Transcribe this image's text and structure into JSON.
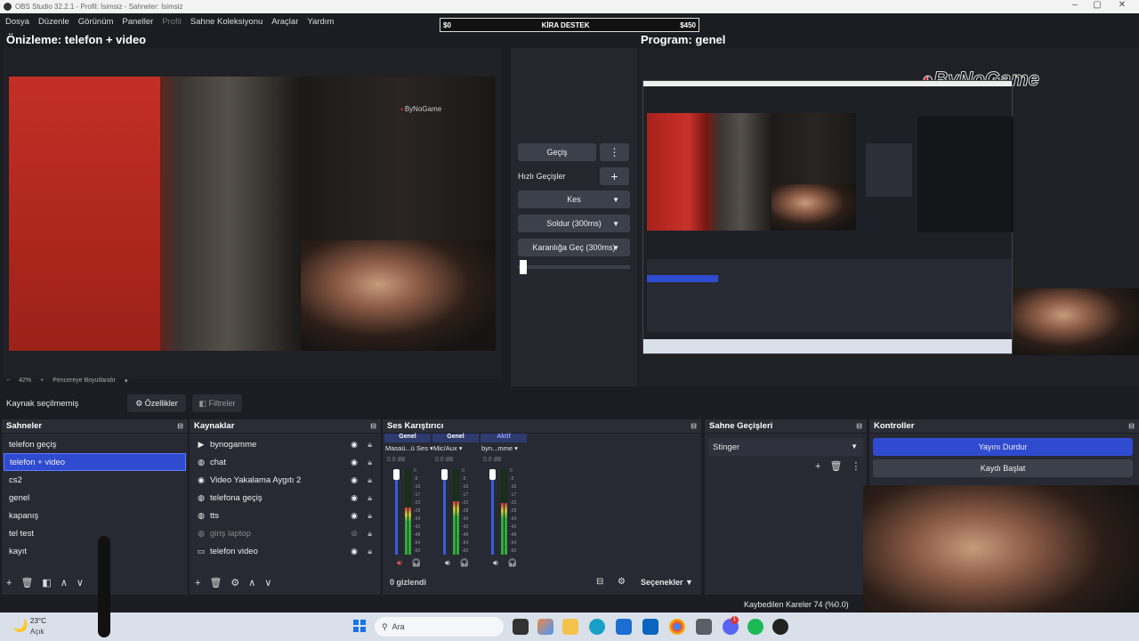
{
  "window": {
    "title": "OBS Studio 32.2.1 - Profil: İsimsiz - Sahneler: İsimsiz",
    "min": "–",
    "max": "▢",
    "close": "✕"
  },
  "menu": [
    "Dosya",
    "Düzenle",
    "Görünüm",
    "Paneller",
    "Profil",
    "Sahne Koleksiyonu",
    "Araçlar",
    "Yardım"
  ],
  "rent": {
    "left": "$0",
    "title": "KİRA DESTEK",
    "right": "$450"
  },
  "preview": {
    "title": "Önizleme: telefon + video",
    "zoom_minus": "−",
    "zoom": "42%",
    "zoom_plus": "+",
    "fit": "Pencereye Boyutlandır",
    "watermark": "ByNoGame"
  },
  "program": {
    "title": "Program: genel",
    "watermark": "ByNoGame"
  },
  "transitions": {
    "gecis": "Geçiş",
    "quick": "Hızlı Geçişler",
    "kes": "Kes",
    "soldur": "Soldur (300ms)",
    "karanlik": "Karanlığa Geç (300ms)",
    "slider": 0.02
  },
  "sourcebar": {
    "status": "Kaynak seçilmemiş",
    "props": "Özellikler",
    "filters": "Filtreler"
  },
  "scenes": {
    "title": "Sahneler",
    "items": [
      "telefon geçiş",
      "telefon + video",
      "cs2",
      "genel",
      "kapanış",
      "tel test",
      "kayıt"
    ],
    "selected": 1
  },
  "sources": {
    "title": "Kaynaklar",
    "items": [
      {
        "icon": "play-icon",
        "glyph": "▶",
        "name": "bynogamme",
        "hidden": false
      },
      {
        "icon": "globe-icon",
        "glyph": "◍",
        "name": "chat",
        "hidden": false
      },
      {
        "icon": "camera-icon",
        "glyph": "◉",
        "name": "Video Yakalama Aygıtı 2",
        "hidden": false
      },
      {
        "icon": "globe-icon",
        "glyph": "◍",
        "name": "telefona geçiş",
        "hidden": false
      },
      {
        "icon": "globe-icon",
        "glyph": "◍",
        "name": "tts",
        "hidden": false
      },
      {
        "icon": "globe-icon",
        "glyph": "◍",
        "name": "giriş laptop",
        "hidden": true
      },
      {
        "icon": "window-icon",
        "glyph": "▭",
        "name": "telefon video",
        "hidden": false
      }
    ]
  },
  "mixer": {
    "title": "Ses Karıştırıcı",
    "hidden_label": "0 gizlendi",
    "options": "Seçenekler",
    "channels": [
      {
        "tag": "Genel",
        "name": "Masaü...ü Ses",
        "db": "0.0 dB",
        "level": 0.55,
        "muted": true
      },
      {
        "tag": "Genel",
        "name": "Mic/Aux",
        "db": "0.0 dB",
        "level": 0.62,
        "muted": false
      },
      {
        "tag": "Aktif",
        "name": "byn...mme",
        "db": "0.0 dB",
        "level": 0.6,
        "muted": false
      }
    ],
    "scale": [
      "0",
      "-5",
      "-10",
      "-17",
      "-22",
      "-28",
      "-34",
      "-42",
      "-48",
      "-54",
      "-60"
    ]
  },
  "scene_transitions": {
    "title": "Sahne Geçişleri",
    "value": "Stinger"
  },
  "controls": {
    "title": "Kontroller",
    "stop_stream": "Yayını Durdur",
    "start_rec": "Kaydı Başlat"
  },
  "status": {
    "dropped": "Kaybedilen Kareler 74 (%0.0)"
  },
  "weather": {
    "temp": "23°C",
    "desc": "Açık"
  },
  "taskbar": {
    "search": "Ara",
    "badge": "1"
  },
  "colors": {
    "accent": "#2f4bd0",
    "bg": "#1c1d23",
    "panel": "#272a33"
  }
}
